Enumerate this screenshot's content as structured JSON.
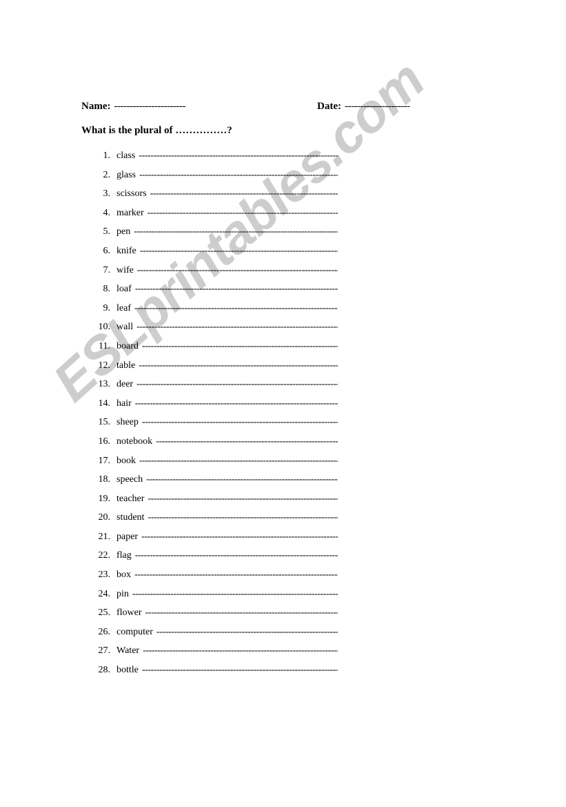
{
  "header": {
    "name_label": "Name:",
    "name_rule": "-----------------------",
    "date_label": "Date:",
    "date_rule": "---------------------"
  },
  "prompt": {
    "text": "What is the plural of ……………?"
  },
  "list": {
    "rule": "-------------------------------------------------------------------------",
    "items": [
      {
        "num": "1.",
        "word": "class"
      },
      {
        "num": "2.",
        "word": "glass"
      },
      {
        "num": "3.",
        "word": "scissors"
      },
      {
        "num": "4.",
        "word": "marker"
      },
      {
        "num": "5.",
        "word": "pen"
      },
      {
        "num": "6.",
        "word": "knife"
      },
      {
        "num": "7.",
        "word": "wife"
      },
      {
        "num": "8.",
        "word": "loaf"
      },
      {
        "num": "9.",
        "word": "leaf"
      },
      {
        "num": "10.",
        "word": "wall"
      },
      {
        "num": "11.",
        "word": "board"
      },
      {
        "num": "12.",
        "word": "table"
      },
      {
        "num": "13.",
        "word": "deer"
      },
      {
        "num": "14.",
        "word": "hair"
      },
      {
        "num": "15.",
        "word": "sheep"
      },
      {
        "num": "16.",
        "word": "notebook"
      },
      {
        "num": "17.",
        "word": "book"
      },
      {
        "num": "18.",
        "word": "speech"
      },
      {
        "num": "19.",
        "word": "teacher"
      },
      {
        "num": "20.",
        "word": "student"
      },
      {
        "num": "21.",
        "word": "paper"
      },
      {
        "num": "22.",
        "word": "flag"
      },
      {
        "num": "23.",
        "word": "box"
      },
      {
        "num": "24.",
        "word": "pin"
      },
      {
        "num": "25.",
        "word": "flower"
      },
      {
        "num": "26.",
        "word": "computer"
      },
      {
        "num": "27.",
        "word": "Water"
      },
      {
        "num": "28.",
        "word": "bottle"
      }
    ]
  },
  "watermark": {
    "text": "ESLprintables.com",
    "color": "#cdcdcd"
  }
}
